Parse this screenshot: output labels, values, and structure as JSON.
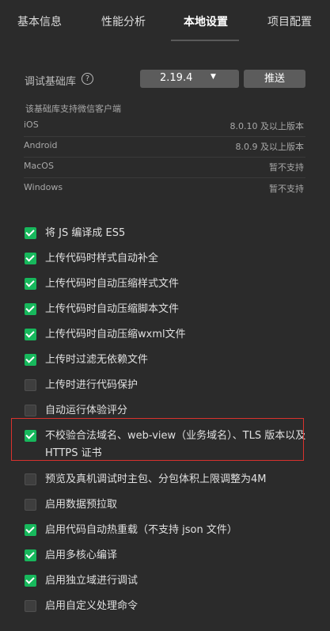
{
  "tabs": [
    {
      "label": "基本信息",
      "active": false
    },
    {
      "label": "性能分析",
      "active": false
    },
    {
      "label": "本地设置",
      "active": true
    },
    {
      "label": "项目配置",
      "active": false
    }
  ],
  "debug_lib": {
    "label": "调试基础库",
    "help_icon": "?",
    "version": "2.19.4",
    "push_label": "推送"
  },
  "support": {
    "note": "该基础库支持微信客户端",
    "clients": [
      {
        "name": "iOS",
        "version": "8.0.10 及以上版本"
      },
      {
        "name": "Android",
        "version": "8.0.9 及以上版本"
      },
      {
        "name": "MacOS",
        "version": "暂不支持"
      },
      {
        "name": "Windows",
        "version": "暂不支持"
      }
    ]
  },
  "options": [
    {
      "label": "将 JS 编译成 ES5",
      "checked": true
    },
    {
      "label": "上传代码时样式自动补全",
      "checked": true
    },
    {
      "label": "上传代码时自动压缩样式文件",
      "checked": true
    },
    {
      "label": "上传代码时自动压缩脚本文件",
      "checked": true
    },
    {
      "label": "上传代码时自动压缩wxml文件",
      "checked": true
    },
    {
      "label": "上传时过滤无依赖文件",
      "checked": true
    },
    {
      "label": "上传时进行代码保护",
      "checked": false
    },
    {
      "label": "自动运行体验评分",
      "checked": false
    },
    {
      "label": "不校验合法域名、web-view（业务域名）、TLS 版本以及 HTTPS 证书",
      "checked": true
    },
    {
      "label": "预览及真机调试时主包、分包体积上限调整为4M",
      "checked": false
    },
    {
      "label": "启用数据预拉取",
      "checked": false
    },
    {
      "label": "启用代码自动热重载（不支持 json 文件）",
      "checked": true
    },
    {
      "label": "启用多核心编译",
      "checked": true
    },
    {
      "label": "启用独立域进行调试",
      "checked": true
    },
    {
      "label": "启用自定义处理命令",
      "checked": false
    }
  ],
  "colors": {
    "accent_green": "#17b85c",
    "highlight_red": "#d9322e",
    "background": "#2b2b2b"
  }
}
